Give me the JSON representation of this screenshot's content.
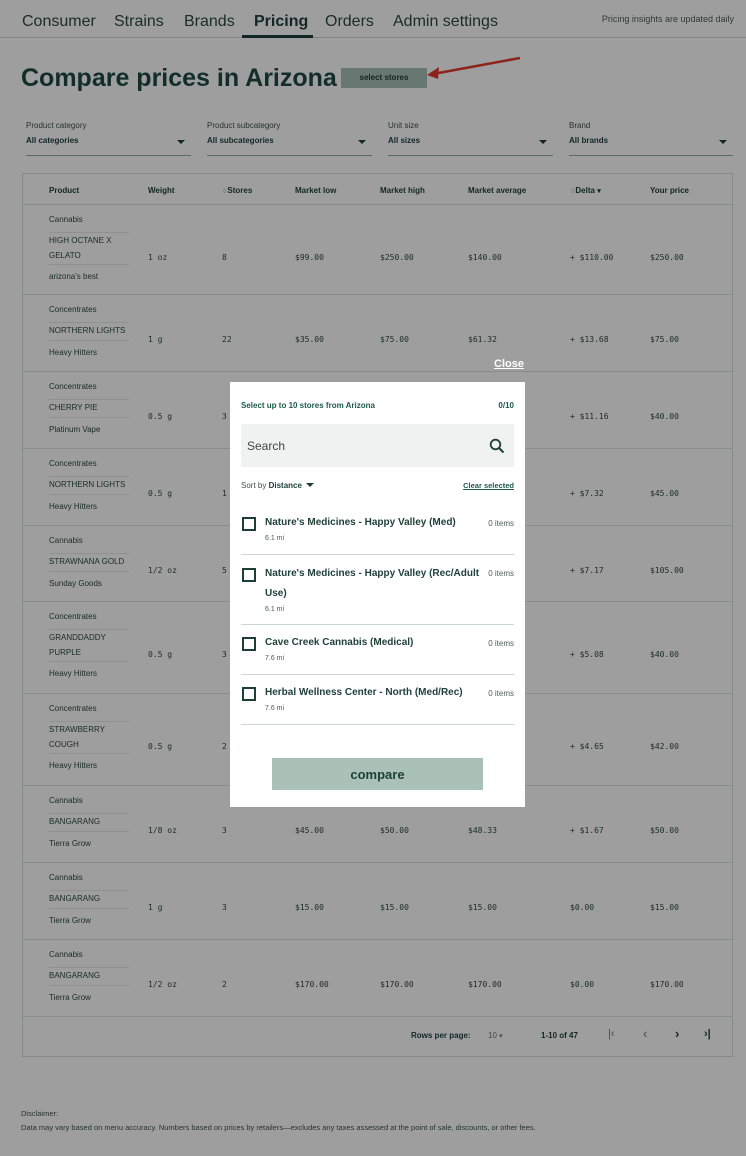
{
  "nav": {
    "items": [
      "Consumer",
      "Strains",
      "Brands",
      "Pricing",
      "Orders",
      "Admin settings"
    ],
    "note": "Pricing insights are updated daily"
  },
  "page": {
    "title": "Compare prices in Arizona",
    "select_stores_label": "select stores"
  },
  "filters": [
    {
      "label": "Product category",
      "value": "All categories"
    },
    {
      "label": "Product subcategory",
      "value": "All subcategories"
    },
    {
      "label": "Unit size",
      "value": "All sizes"
    },
    {
      "label": "Brand",
      "value": "All brands"
    }
  ],
  "table": {
    "headers": [
      "Product",
      "Weight",
      "Stores",
      "Market low",
      "Market high",
      "Market average",
      "Delta",
      "Your price"
    ],
    "rows": [
      {
        "category": "Cannabis",
        "name": "HIGH OCTANE X GELATO",
        "brand": "arizona's best",
        "weight": "1 oz",
        "stores": "8",
        "low": "$99.00",
        "high": "$250.00",
        "avg": "$140.00",
        "delta": "+ $110.00",
        "price": "$250.00"
      },
      {
        "category": "Concentrates",
        "name": "NORTHERN LIGHTS",
        "brand": "Heavy Hitters",
        "weight": "1 g",
        "stores": "22",
        "low": "$35.00",
        "high": "$75.00",
        "avg": "$61.32",
        "delta": "+ $13.68",
        "price": "$75.00"
      },
      {
        "category": "Concentrates",
        "name": "CHERRY PIE",
        "brand": "Platinum Vape",
        "weight": "0.5 g",
        "stores": "3",
        "low": "",
        "high": "",
        "avg": "",
        "delta": "+ $11.16",
        "price": "$40.00"
      },
      {
        "category": "Concentrates",
        "name": "NORTHERN LIGHTS",
        "brand": "Heavy Hitters",
        "weight": "0.5 g",
        "stores": "1",
        "low": "",
        "high": "",
        "avg": "",
        "delta": "+ $7.32",
        "price": "$45.00"
      },
      {
        "category": "Cannabis",
        "name": "STRAWNANA GOLD",
        "brand": "Sunday Goods",
        "weight": "1/2 oz",
        "stores": "5",
        "low": "",
        "high": "",
        "avg": "",
        "delta": "+ $7.17",
        "price": "$105.00"
      },
      {
        "category": "Concentrates",
        "name": "GRANDDADDY PURPLE",
        "brand": "Heavy Hitters",
        "weight": "0.5 g",
        "stores": "3",
        "low": "",
        "high": "",
        "avg": "",
        "delta": "+ $5.08",
        "price": "$40.00"
      },
      {
        "category": "Concentrates",
        "name": "STRAWBERRY COUGH",
        "brand": "Heavy Hitters",
        "weight": "0.5 g",
        "stores": "2",
        "low": "",
        "high": "",
        "avg": "",
        "delta": "+ $4.65",
        "price": "$42.00"
      },
      {
        "category": "Cannabis",
        "name": "BANGARANG",
        "brand": "Tierra Grow",
        "weight": "1/8 oz",
        "stores": "3",
        "low": "$45.00",
        "high": "$50.00",
        "avg": "$48.33",
        "delta": "+ $1.67",
        "price": "$50.00"
      },
      {
        "category": "Cannabis",
        "name": "BANGARANG",
        "brand": "Tierra Grow",
        "weight": "1 g",
        "stores": "3",
        "low": "$15.00",
        "high": "$15.00",
        "avg": "$15.00",
        "delta": "$0.00",
        "price": "$15.00"
      },
      {
        "category": "Cannabis",
        "name": "BANGARANG",
        "brand": "Tierra Grow",
        "weight": "1/2 oz",
        "stores": "2",
        "low": "$170.00",
        "high": "$170.00",
        "avg": "$170.00",
        "delta": "$0.00",
        "price": "$170.00"
      }
    ]
  },
  "pagination": {
    "rows_per_page_label": "Rows per page:",
    "rows_per_page_value": "10",
    "range": "1-10 of 47"
  },
  "disclaimer": {
    "title": "Disclaimer:",
    "text": "Data may vary based on menu accuracy. Numbers based on prices by retailers—excludes any taxes assessed at the point of sale, discounts, or other fees."
  },
  "modal": {
    "close_label": "Close",
    "heading": "Select up to 10 stores from Arizona",
    "count": "0/10",
    "search_placeholder": "Search",
    "sort_prefix": "Sort by",
    "sort_value": "Distance",
    "clear_label": "Clear selected",
    "stores": [
      {
        "name": "Nature's Medicines - Happy Valley (Med)",
        "items": "0 items",
        "distance": "6.1 mi"
      },
      {
        "name": "Nature's Medicines - Happy Valley (Rec/Adult Use)",
        "items": "0 items",
        "distance": "6.1 mi"
      },
      {
        "name": "Cave Creek Cannabis (Medical)",
        "items": "0 items",
        "distance": "7.6 mi"
      },
      {
        "name": "Herbal Wellness Center - North (Med/Rec)",
        "items": "0 items",
        "distance": "7.6 mi"
      }
    ],
    "compare_label": "compare"
  }
}
